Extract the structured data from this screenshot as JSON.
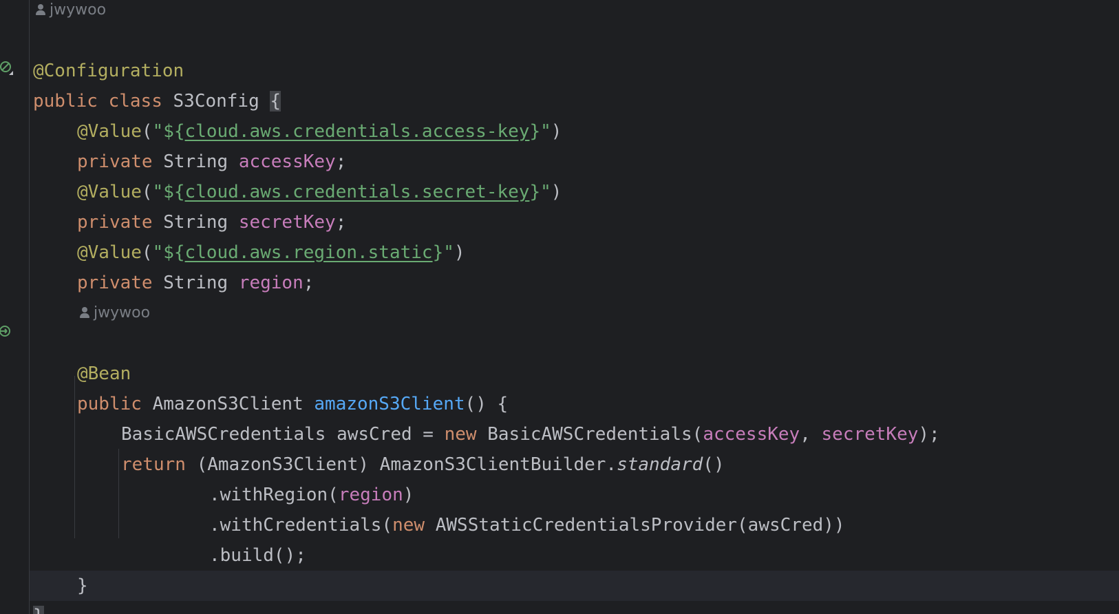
{
  "editor": {
    "author_hints": [
      "jwywoo",
      "jwywoo"
    ],
    "gutter_icons": [
      "spring-bean-icon",
      "spring-bean-icon"
    ],
    "lines": {
      "l1": {
        "ann": "@Configuration"
      },
      "l2": {
        "kw1": "public",
        "kw2": "class",
        "name": "S3Config",
        "brace": "{"
      },
      "l3": {
        "ann": "@Value",
        "p1": "(",
        "q1": "\"${",
        "ref": "cloud.aws.credentials.access-key",
        "q2": "}\"",
        "p2": ")"
      },
      "l4": {
        "kw": "private",
        "type": "String",
        "field": "accessKey",
        "semi": ";"
      },
      "l5": {
        "ann": "@Value",
        "p1": "(",
        "q1": "\"${",
        "ref": "cloud.aws.credentials.secret-key",
        "q2": "}\"",
        "p2": ")"
      },
      "l6": {
        "kw": "private",
        "type": "String",
        "field": "secretKey",
        "semi": ";"
      },
      "l7": {
        "ann": "@Value",
        "p1": "(",
        "q1": "\"${",
        "ref": "cloud.aws.region.static",
        "q2": "}\"",
        "p2": ")"
      },
      "l8": {
        "kw": "private",
        "type": "String",
        "field": "region",
        "semi": ";"
      },
      "l9": {
        "ann": "@Bean"
      },
      "l10": {
        "kw": "public",
        "type": "AmazonS3Client",
        "fn": "amazonS3Client",
        "rest": "() {"
      },
      "l11": {
        "t1": "BasicAWSCredentials awsCred = ",
        "kw": "new",
        "t2": " BasicAWSCredentials(",
        "f1": "accessKey",
        "t3": ", ",
        "f2": "secretKey",
        "t4": ");"
      },
      "l12": {
        "kw": "return",
        "t1": " (AmazonS3Client) AmazonS3ClientBuilder.",
        "it": "standard",
        "t2": "()"
      },
      "l13": {
        "t1": ".withRegion(",
        "f1": "region",
        "t2": ")"
      },
      "l14": {
        "t1": ".withCredentials(",
        "kw": "new",
        "t2": " AWSStaticCredentialsProvider(awsCred))"
      },
      "l15": {
        "t1": ".build();"
      },
      "l16": {
        "t1": "}"
      },
      "l17": {
        "t1": "}"
      }
    }
  }
}
